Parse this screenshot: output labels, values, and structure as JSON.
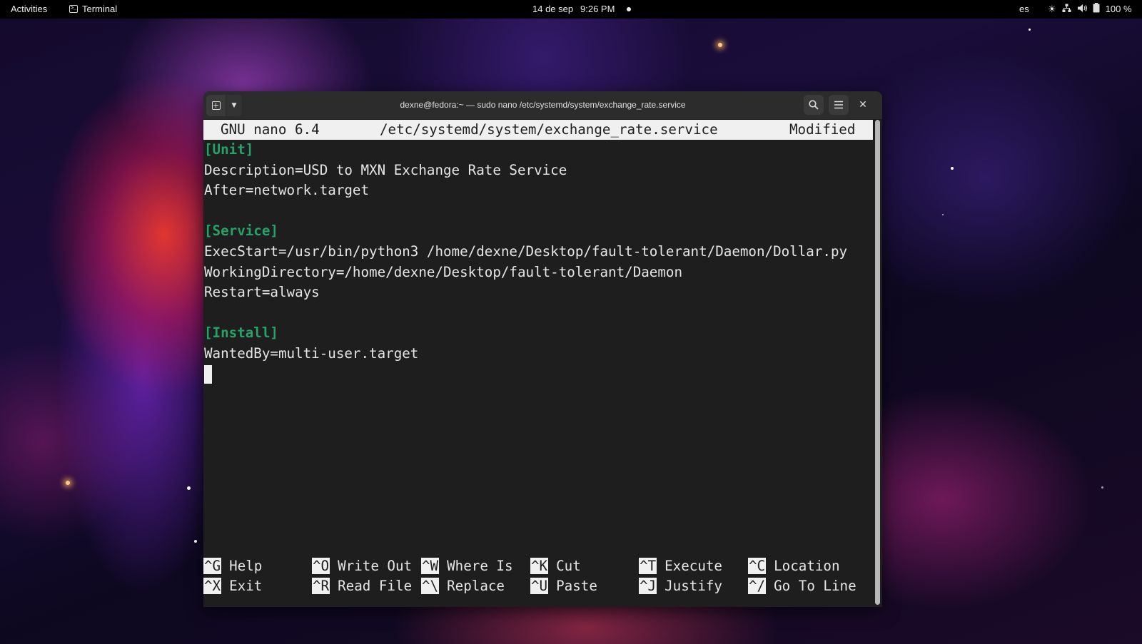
{
  "topbar": {
    "activities": "Activities",
    "app_name": "Terminal",
    "date": "14 de sep",
    "time": "9:26 PM",
    "language": "es",
    "battery": "100 %",
    "tray_icons": [
      "brightness-icon",
      "network-icon",
      "volume-icon",
      "battery-icon"
    ]
  },
  "window": {
    "title": "dexne@fedora:~ — sudo nano /etc/systemd/system/exchange_rate.service"
  },
  "nano": {
    "version": "GNU nano 6.4",
    "filename": "/etc/systemd/system/exchange_rate.service",
    "status": "Modified",
    "lines": [
      {
        "text": "[Unit]",
        "section": true
      },
      {
        "text": "Description=USD to MXN Exchange Rate Service",
        "section": false
      },
      {
        "text": "After=network.target",
        "section": false
      },
      {
        "text": "",
        "section": false
      },
      {
        "text": "[Service]",
        "section": true
      },
      {
        "text": "ExecStart=/usr/bin/python3 /home/dexne/Desktop/fault-tolerant/Daemon/Dollar.py",
        "section": false
      },
      {
        "text": "WorkingDirectory=/home/dexne/Desktop/fault-tolerant/Daemon",
        "section": false
      },
      {
        "text": "Restart=always",
        "section": false
      },
      {
        "text": "",
        "section": false
      },
      {
        "text": "[Install]",
        "section": true
      },
      {
        "text": "WantedBy=multi-user.target",
        "section": false
      }
    ],
    "shortcuts_row1": [
      {
        "key": "^G",
        "label": "Help"
      },
      {
        "key": "^O",
        "label": "Write Out"
      },
      {
        "key": "^W",
        "label": "Where Is"
      },
      {
        "key": "^K",
        "label": "Cut"
      },
      {
        "key": "^T",
        "label": "Execute"
      },
      {
        "key": "^C",
        "label": "Location"
      }
    ],
    "shortcuts_row2": [
      {
        "key": "^X",
        "label": "Exit"
      },
      {
        "key": "^R",
        "label": "Read File"
      },
      {
        "key": "^\\",
        "label": "Replace"
      },
      {
        "key": "^U",
        "label": "Paste"
      },
      {
        "key": "^J",
        "label": "Justify"
      },
      {
        "key": "^/",
        "label": "Go To Line"
      }
    ]
  },
  "colors": {
    "section_header": "#26a269",
    "terminal_bg": "#1e1e1e",
    "terminal_fg": "#e6e6e6"
  }
}
